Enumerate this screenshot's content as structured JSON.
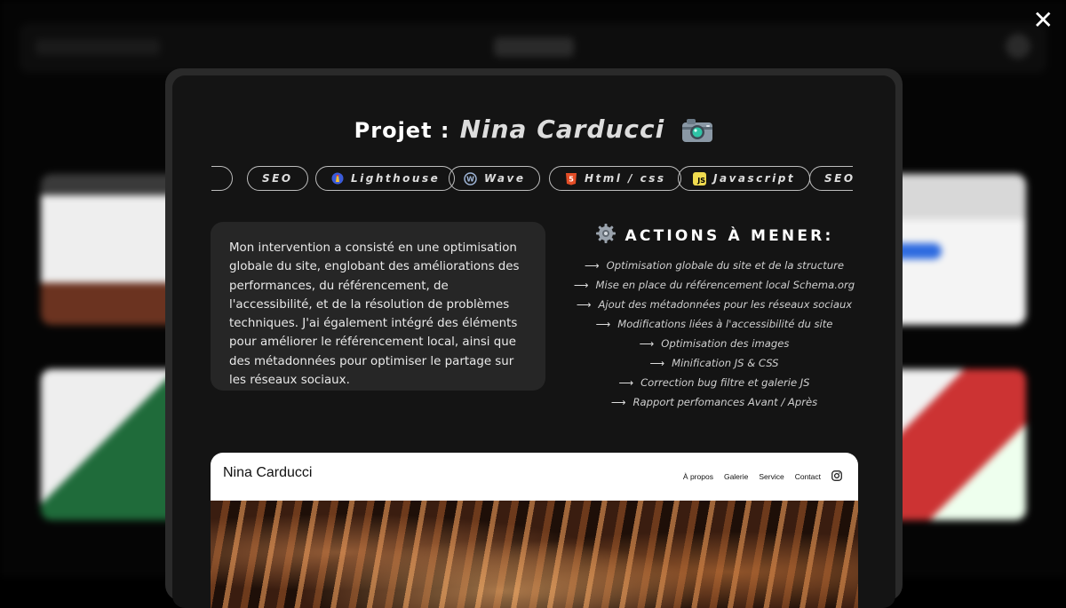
{
  "close_label": "✕",
  "modal": {
    "title_prefix": "Projet :",
    "title_name": "Nina Carducci",
    "tags": [
      {
        "label": "SEO",
        "icon": "none"
      },
      {
        "label": "Lighthouse",
        "icon": "lighthouse-icon"
      },
      {
        "label": "Wave",
        "icon": "wave-icon"
      },
      {
        "label": "Html / css",
        "icon": "html5-icon"
      },
      {
        "label": "Javascript",
        "icon": "js-icon"
      },
      {
        "label": "SEO",
        "icon": "none"
      }
    ],
    "description": "Mon intervention a consisté en une optimisation globale du site, englobant des améliorations des performances, du référencement, de l'accessibilité, et de la résolution de problèmes techniques. J'ai également intégré des éléments pour améliorer le référencement local, ainsi que des métadonnées pour optimiser le partage sur les réseaux sociaux.",
    "actions_title": "ACTIONS À MENER:",
    "actions": [
      "Optimisation globale du site et de la structure",
      "Mise en place du référencement local Schema.org",
      "Ajout des métadonnées pour les réseaux sociaux",
      "Modifications liées à l'accessibilité du site",
      "Optimisation des images",
      "Minification JS & CSS",
      "Correction bug filtre et galerie JS",
      "Rapport perfomances Avant / Après"
    ],
    "preview": {
      "brand": "Nina Carducci",
      "nav": [
        "À propos",
        "Galerie",
        "Service",
        "Contact"
      ]
    }
  },
  "colors": {
    "modal_bg": "#141414",
    "card_bg": "#262626",
    "tag_border": "#bdbdbd"
  }
}
